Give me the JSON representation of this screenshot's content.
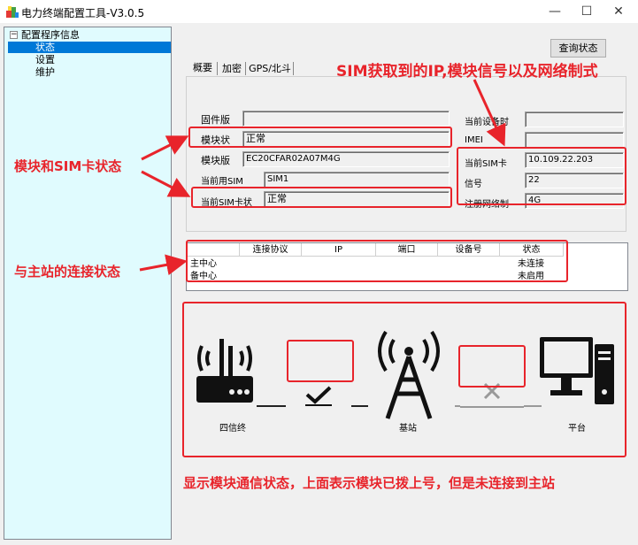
{
  "window": {
    "title": "电力终端配置工具-V3.0.5",
    "min": "—",
    "max": "☐",
    "close": "✕"
  },
  "tree": {
    "root": "配置程序信息",
    "collapse_sign": "−",
    "items": [
      "状态",
      "设置",
      "维护"
    ]
  },
  "buttons": {
    "query_status": "查询状态"
  },
  "tabs": [
    "概要",
    "加密",
    "GPS/北斗"
  ],
  "fields": {
    "firmware": {
      "label": "固件版",
      "value": ""
    },
    "module_status": {
      "label": "模块状",
      "value": "正常"
    },
    "module_version": {
      "label": "模块版",
      "value": "EC20CFAR02A07M4G"
    },
    "current_sim": {
      "label": "当前用SIM",
      "value": "SIM1"
    },
    "sim_status": {
      "label": "当前SIM卡状",
      "value": "正常"
    },
    "device_time": {
      "label": "当前设备时",
      "value": ""
    },
    "imei": {
      "label": "IMEI",
      "value": ""
    },
    "sim_ip": {
      "label": "当前SIM卡",
      "value": "10.109.22.203"
    },
    "signal": {
      "label": "信号",
      "value": "22"
    },
    "network": {
      "label": "注册网络制",
      "value": "4G"
    }
  },
  "table": {
    "headers": [
      "",
      "连接协议",
      "IP",
      "端口",
      "设备号",
      "状态"
    ],
    "rows": [
      [
        "主中心",
        "",
        "",
        "",
        "",
        "未连接"
      ],
      [
        "备中心",
        "",
        "",
        "",
        "",
        "未启用"
      ]
    ]
  },
  "diagram": {
    "device": "四信终",
    "station": "基站",
    "platform": "平台",
    "link1_state": "connected",
    "link2_state": "disconnected"
  },
  "annotations": {
    "top": "SIM获取到的IP,模块信号以及网络制式",
    "left1": "模块和SIM卡状态",
    "left2": "与主站的连接状态",
    "bottom": "显示模块通信状态，上面表示模块已拨上号，但是未连接到主站"
  },
  "colors": {
    "annotation": "#e8242b",
    "selection": "#0078d7",
    "tree_bg": "#e0fbfe"
  }
}
